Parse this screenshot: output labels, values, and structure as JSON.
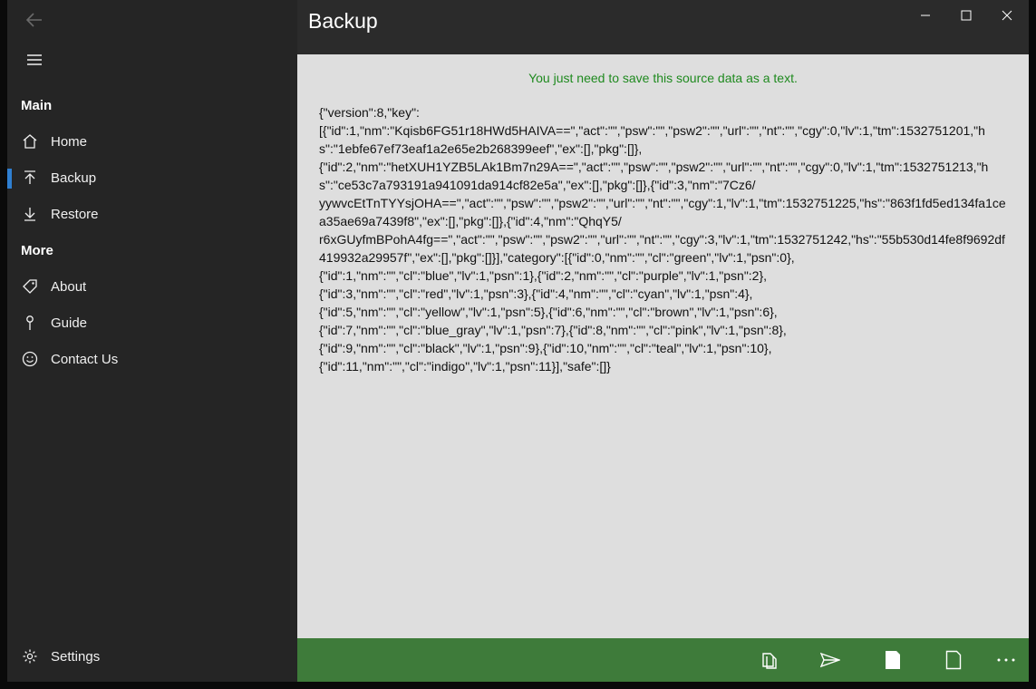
{
  "window": {
    "title": "Backup"
  },
  "sidebar": {
    "sections": [
      {
        "header": "Main",
        "items": [
          {
            "label": "Home",
            "icon": "home-icon"
          },
          {
            "label": "Backup",
            "icon": "upload-icon",
            "selected": true
          },
          {
            "label": "Restore",
            "icon": "download-icon"
          }
        ]
      },
      {
        "header": "More",
        "items": [
          {
            "label": "About",
            "icon": "tag-icon"
          },
          {
            "label": "Guide",
            "icon": "pin-icon"
          },
          {
            "label": "Contact Us",
            "icon": "smiley-icon"
          }
        ]
      }
    ],
    "settings_label": "Settings",
    "accent_color": "#2f7fd1"
  },
  "main": {
    "hint": "You just need to save this source data as a text.",
    "source_text": "{\"version\":8,\"key\":\n[{\"id\":1,\"nm\":\"Kqisb6FG51r18HWd5HAIVA==\",\"act\":\"\",\"psw\":\"\",\"psw2\":\"\",\"url\":\"\",\"nt\":\"\",\"cgy\":0,\"lv\":1,\"tm\":1532751201,\"hs\":\"1ebfe67ef73eaf1a2e65e2b268399eef\",\"ex\":[],\"pkg\":[]},\n{\"id\":2,\"nm\":\"hetXUH1YZB5LAk1Bm7n29A==\",\"act\":\"\",\"psw\":\"\",\"psw2\":\"\",\"url\":\"\",\"nt\":\"\",\"cgy\":0,\"lv\":1,\"tm\":1532751213,\"hs\":\"ce53c7a793191a941091da914cf82e5a\",\"ex\":[],\"pkg\":[]},{\"id\":3,\"nm\":\"7Cz6/\nyywvcEtTnTYYsjOHA==\",\"act\":\"\",\"psw\":\"\",\"psw2\":\"\",\"url\":\"\",\"nt\":\"\",\"cgy\":1,\"lv\":1,\"tm\":1532751225,\"hs\":\"863f1fd5ed134fa1cea35ae69a7439f8\",\"ex\":[],\"pkg\":[]},{\"id\":4,\"nm\":\"QhqY5/\nr6xGUyfmBPohA4fg==\",\"act\":\"\",\"psw\":\"\",\"psw2\":\"\",\"url\":\"\",\"nt\":\"\",\"cgy\":3,\"lv\":1,\"tm\":1532751242,\"hs\":\"55b530d14fe8f9692df419932a29957f\",\"ex\":[],\"pkg\":[]}],\"category\":[{\"id\":0,\"nm\":\"\",\"cl\":\"green\",\"lv\":1,\"psn\":0},\n{\"id\":1,\"nm\":\"\",\"cl\":\"blue\",\"lv\":1,\"psn\":1},{\"id\":2,\"nm\":\"\",\"cl\":\"purple\",\"lv\":1,\"psn\":2},\n{\"id\":3,\"nm\":\"\",\"cl\":\"red\",\"lv\":1,\"psn\":3},{\"id\":4,\"nm\":\"\",\"cl\":\"cyan\",\"lv\":1,\"psn\":4},\n{\"id\":5,\"nm\":\"\",\"cl\":\"yellow\",\"lv\":1,\"psn\":5},{\"id\":6,\"nm\":\"\",\"cl\":\"brown\",\"lv\":1,\"psn\":6},\n{\"id\":7,\"nm\":\"\",\"cl\":\"blue_gray\",\"lv\":1,\"psn\":7},{\"id\":8,\"nm\":\"\",\"cl\":\"pink\",\"lv\":1,\"psn\":8},\n{\"id\":9,\"nm\":\"\",\"cl\":\"black\",\"lv\":1,\"psn\":9},{\"id\":10,\"nm\":\"\",\"cl\":\"teal\",\"lv\":1,\"psn\":10},\n{\"id\":11,\"nm\":\"\",\"cl\":\"indigo\",\"lv\":1,\"psn\":11}],\"safe\":[]}",
    "hint_color": "#1f8a1f"
  },
  "bottom_bar": {
    "color": "#3e7b3a",
    "buttons": [
      "copy-icon",
      "send-icon",
      "page-filled-icon",
      "page-outline-icon",
      "more-icon"
    ]
  }
}
